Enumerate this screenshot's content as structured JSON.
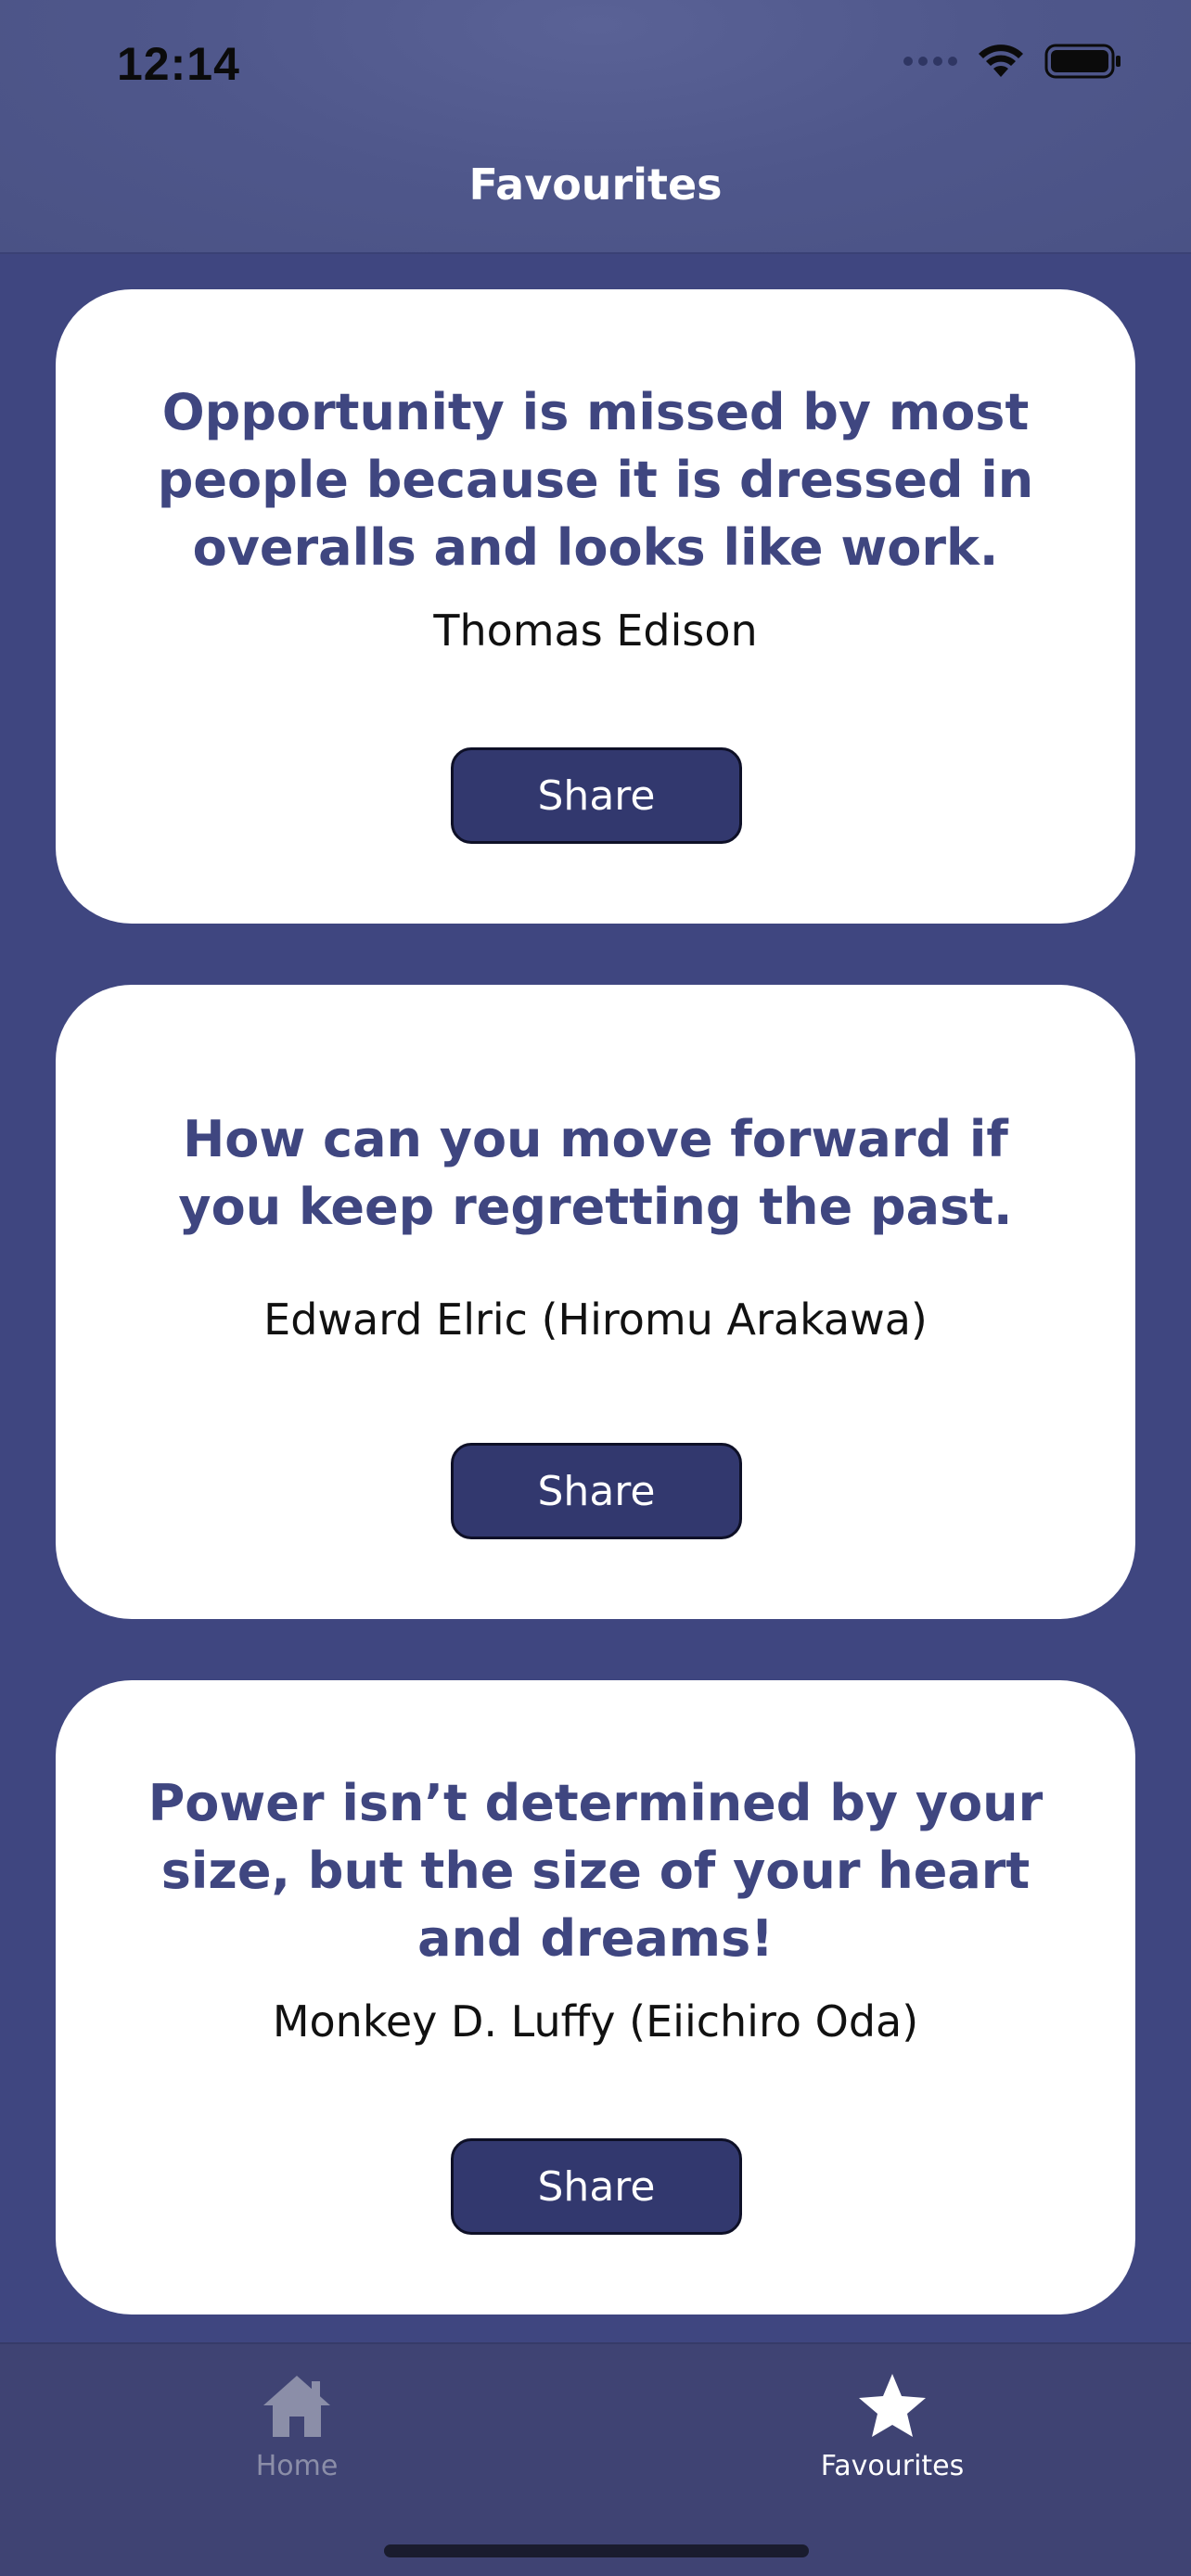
{
  "status_bar": {
    "time": "12:14"
  },
  "nav": {
    "title": "Favourites"
  },
  "quotes": [
    {
      "text": "Opportunity is missed by most people because it is dressed in overalls and looks like work.",
      "author": "Thomas Edison",
      "share_label": "Share"
    },
    {
      "text": "How can you move forward if you keep regretting the past.",
      "author": "Edward Elric (Hiromu Arakawa)",
      "share_label": "Share"
    },
    {
      "text": "Power isn’t determined by your size, but the size of your heart and dreams!",
      "author": "Monkey D. Luffy (Eiichiro Oda)",
      "share_label": "Share"
    }
  ],
  "tabbar": {
    "items": [
      {
        "label": "Home",
        "icon": "home-icon",
        "active": false
      },
      {
        "label": "Favourites",
        "icon": "star-icon",
        "active": true
      }
    ]
  },
  "colors": {
    "background": "#3f4680",
    "accent": "#3f4680",
    "button": "#32386e",
    "active_tab": "#ffffff",
    "inactive_tab": "#8b8ea8"
  }
}
